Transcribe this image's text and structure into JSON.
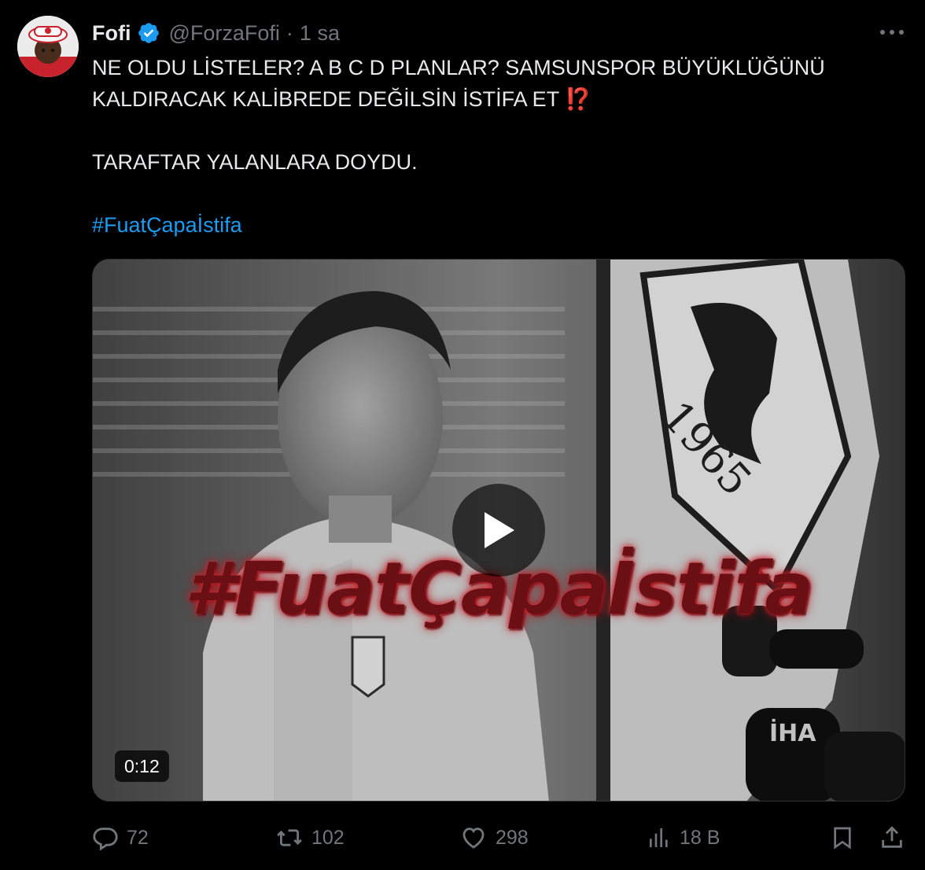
{
  "author": {
    "display_name": "Fofi",
    "handle": "@ForzaFofi",
    "separator": "·",
    "time": "1 sa"
  },
  "tweet": {
    "line1": "NE OLDU LİSTELER? A B C D PLANLAR? SAMSUNSPOR BÜYÜKLÜĞÜNÜ",
    "line2": "KALDIRACAK KALİBREDE DEĞİLSİN İSTİFA ET",
    "line2_emoji": "⁉️",
    "line3": "TARAFTAR YALANLARA DOYDU.",
    "hashtag": "#FuatÇapaİstifa"
  },
  "media": {
    "overlay_text": "#FuatÇapaİstifa",
    "flag_year": "1965",
    "mic_label": "İHA",
    "duration": "0:12"
  },
  "actions": {
    "replies": "72",
    "reposts": "102",
    "likes": "298",
    "views": "18 B"
  },
  "colors": {
    "background": "#000000",
    "text": "#e7e9ea",
    "muted": "#71767b",
    "link": "#1d9bf0",
    "verified": "#1d9bf0",
    "overlay_red": "#b3151e"
  }
}
